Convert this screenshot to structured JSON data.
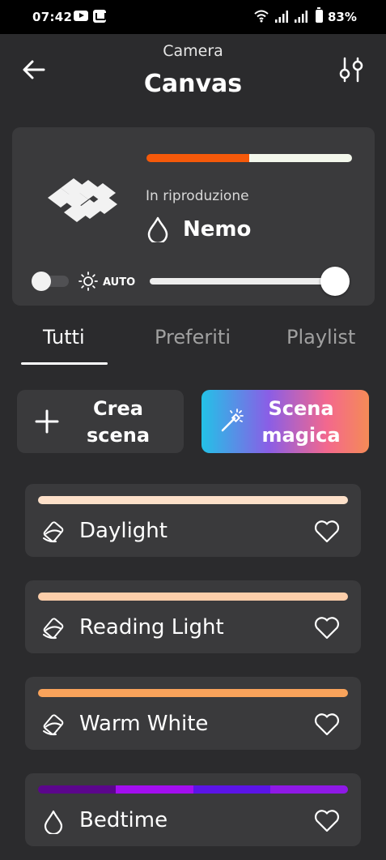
{
  "status_bar": {
    "time": "07:42",
    "battery": "83%"
  },
  "header": {
    "subtitle": "Camera",
    "title": "Canvas"
  },
  "player": {
    "playing_label": "In riproduzione",
    "scene_name": "Nemo",
    "auto_label": "AUTO",
    "power_on": false,
    "brightness_percent": 100,
    "palette": [
      "#f5590a",
      "#f3f7ec"
    ]
  },
  "tabs": [
    {
      "label": "Tutti",
      "active": true
    },
    {
      "label": "Preferiti",
      "active": false
    },
    {
      "label": "Playlist",
      "active": false
    }
  ],
  "actions": {
    "create": {
      "line1": "Crea",
      "line2": "scena"
    },
    "magic": {
      "line1": "Scena",
      "line2": "magica"
    }
  },
  "scenes": [
    {
      "name": "Daylight",
      "icon": "color-palette-icon",
      "colors": [
        "#fde0c9"
      ]
    },
    {
      "name": "Reading Light",
      "icon": "color-palette-icon",
      "colors": [
        "#fcceaa"
      ]
    },
    {
      "name": "Warm White",
      "icon": "color-palette-icon",
      "colors": [
        "#f9a35b"
      ]
    },
    {
      "name": "Bedtime",
      "icon": "drop-icon",
      "colors": [
        "#5b068c",
        "#a30ef0",
        "#5b14e7",
        "#8f19e6"
      ]
    }
  ]
}
